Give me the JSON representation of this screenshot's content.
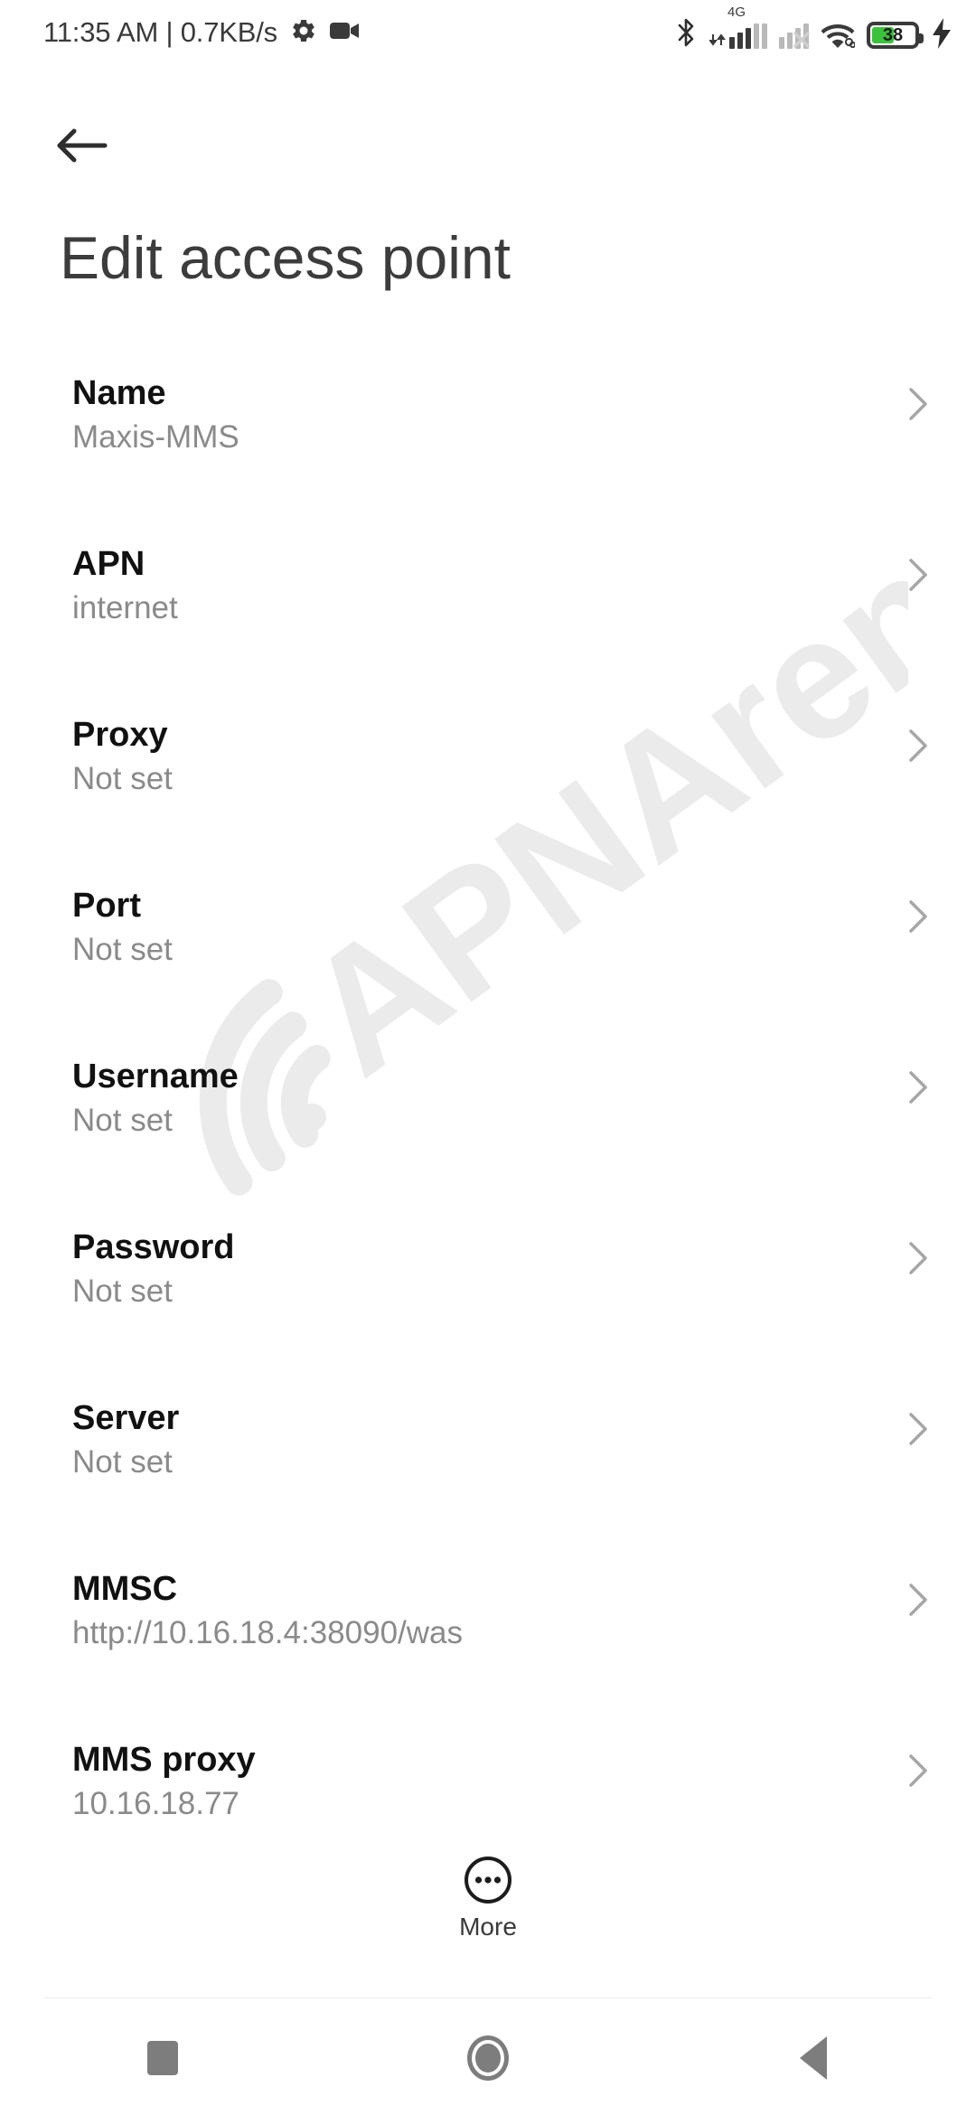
{
  "status_bar": {
    "clock_and_net": "11:35 AM | 0.7KB/s",
    "gear_icon": "gear-icon",
    "video_icon": "video-camera-icon",
    "bluetooth_icon": "bluetooth-icon",
    "network_type": "4G",
    "sim1_icon": "signal-bars-sim1-icon",
    "sim2_icon": "signal-bars-sim2-no-service-icon",
    "wifi_icon": "wifi-icon",
    "battery_level": "38",
    "battery_color": "#3ac23a",
    "charging_icon": "lightning-bolt-icon"
  },
  "app_bar": {
    "back_icon": "arrow-left-icon",
    "title": "Edit access point"
  },
  "watermark": {
    "text": "APNArena",
    "color": "#ebebeb"
  },
  "list": {
    "chevron_icon": "chevron-right-icon",
    "rows": [
      {
        "title": "Name",
        "value": "Maxis-MMS"
      },
      {
        "title": "APN",
        "value": "internet"
      },
      {
        "title": "Proxy",
        "value": "Not set"
      },
      {
        "title": "Port",
        "value": "Not set"
      },
      {
        "title": "Username",
        "value": "Not set"
      },
      {
        "title": "Password",
        "value": "Not set"
      },
      {
        "title": "Server",
        "value": "Not set"
      },
      {
        "title": "MMSC",
        "value": "http://10.16.18.4:38090/was"
      },
      {
        "title": "MMS proxy",
        "value": "10.16.18.77"
      }
    ]
  },
  "more_button": {
    "icon": "more-circle-icon",
    "label": "More"
  },
  "nav_bar": {
    "recents_icon": "square-recents-icon",
    "home_icon": "circle-home-icon",
    "back_icon": "triangle-back-icon"
  }
}
